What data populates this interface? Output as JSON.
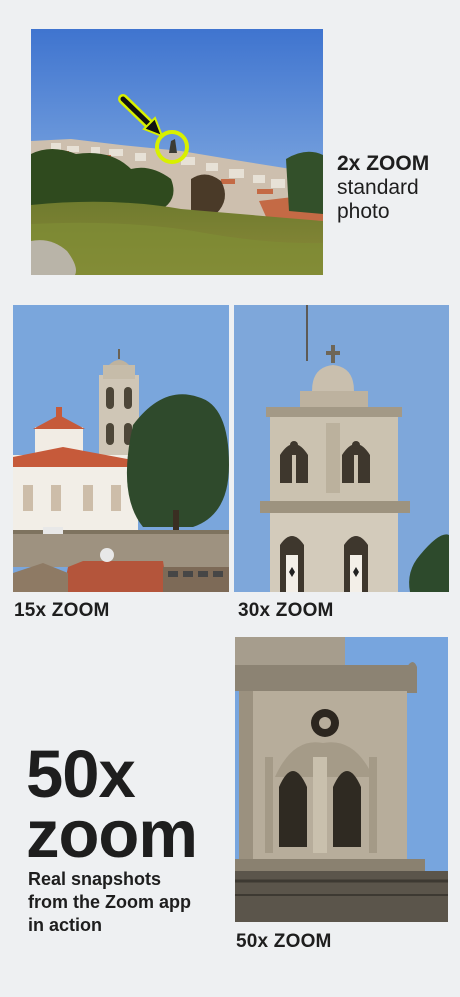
{
  "photo_2x": {
    "caption_line1": "2x ZOOM",
    "caption_line2": "standard",
    "caption_line3": "photo"
  },
  "photo_15x": {
    "caption": "15x ZOOM"
  },
  "photo_30x": {
    "caption": "30x ZOOM"
  },
  "photo_50x": {
    "caption": "50x ZOOM"
  },
  "headline": {
    "line1": "50x",
    "line2": "zoom",
    "tagline_line1": "Real snapshots",
    "tagline_line2": "from the Zoom app",
    "tagline_line3": "in action"
  },
  "colors": {
    "background": "#eef0f2",
    "text": "#1e1e1e",
    "highlight_circle": "#d8f000",
    "sky": "#6fa2dc"
  }
}
